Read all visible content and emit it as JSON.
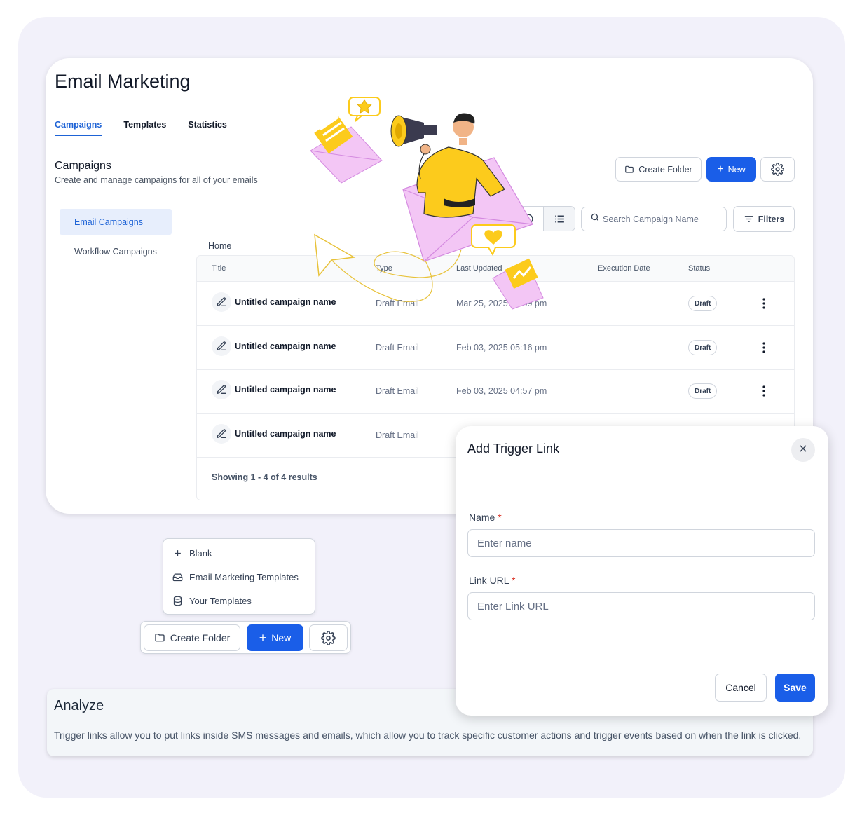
{
  "app": {
    "title": "Email Marketing"
  },
  "tabs": [
    {
      "label": "Campaigns",
      "active": true
    },
    {
      "label": "Templates",
      "active": false
    },
    {
      "label": "Statistics",
      "active": false
    }
  ],
  "section": {
    "title": "Campaigns",
    "subtitle": "Create and manage campaigns for all of your emails"
  },
  "toolbar": {
    "create_folder": "Create Folder",
    "new": "New",
    "settings_icon": "gear-icon"
  },
  "sidebar": {
    "items": [
      {
        "label": "Email Campaigns",
        "active": true
      },
      {
        "label": "Workflow Campaigns",
        "active": false
      }
    ]
  },
  "search": {
    "placeholder": "Search Campaign Name",
    "filters": "Filters"
  },
  "breadcrumb": "Home",
  "table": {
    "columns": [
      "Title",
      "Type",
      "Last Updated",
      "Execution Date",
      "Status"
    ],
    "rows": [
      {
        "title": "Untitled campaign name",
        "type": "Draft Email",
        "updated": "Mar 25, 2025 02:09 pm",
        "execution": "",
        "status": "Draft"
      },
      {
        "title": "Untitled campaign name",
        "type": "Draft Email",
        "updated": "Feb 03, 2025 05:16 pm",
        "execution": "",
        "status": "Draft"
      },
      {
        "title": "Untitled campaign name",
        "type": "Draft Email",
        "updated": "Feb 03, 2025 04:57 pm",
        "execution": "",
        "status": "Draft"
      },
      {
        "title": "Untitled campaign name",
        "type": "Draft Email",
        "updated": "",
        "execution": "",
        "status": ""
      }
    ],
    "showing": "Showing 1 - 4 of 4 results"
  },
  "new_menu": {
    "items": [
      {
        "label": "Blank",
        "icon": "plus-icon"
      },
      {
        "label": "Email Marketing Templates",
        "icon": "inbox-icon"
      },
      {
        "label": "Your Templates",
        "icon": "database-icon"
      }
    ]
  },
  "bottom_toolbar": {
    "create_folder": "Create Folder",
    "new": "New"
  },
  "analyze": {
    "title": "Analyze",
    "text": "Trigger links allow you to put links inside SMS messages and emails, which allow you to track specific customer actions and trigger events based on when the link is clicked."
  },
  "modal": {
    "title": "Add Trigger Link",
    "name_label": "Name",
    "name_placeholder": "Enter name",
    "url_label": "Link URL",
    "url_placeholder": "Enter Link URL",
    "required_mark": "*",
    "cancel": "Cancel",
    "save": "Save"
  },
  "colors": {
    "primary": "#1a5ee8",
    "accent_yellow": "#fccb1c",
    "envelope_pink": "#f3c6f5"
  }
}
